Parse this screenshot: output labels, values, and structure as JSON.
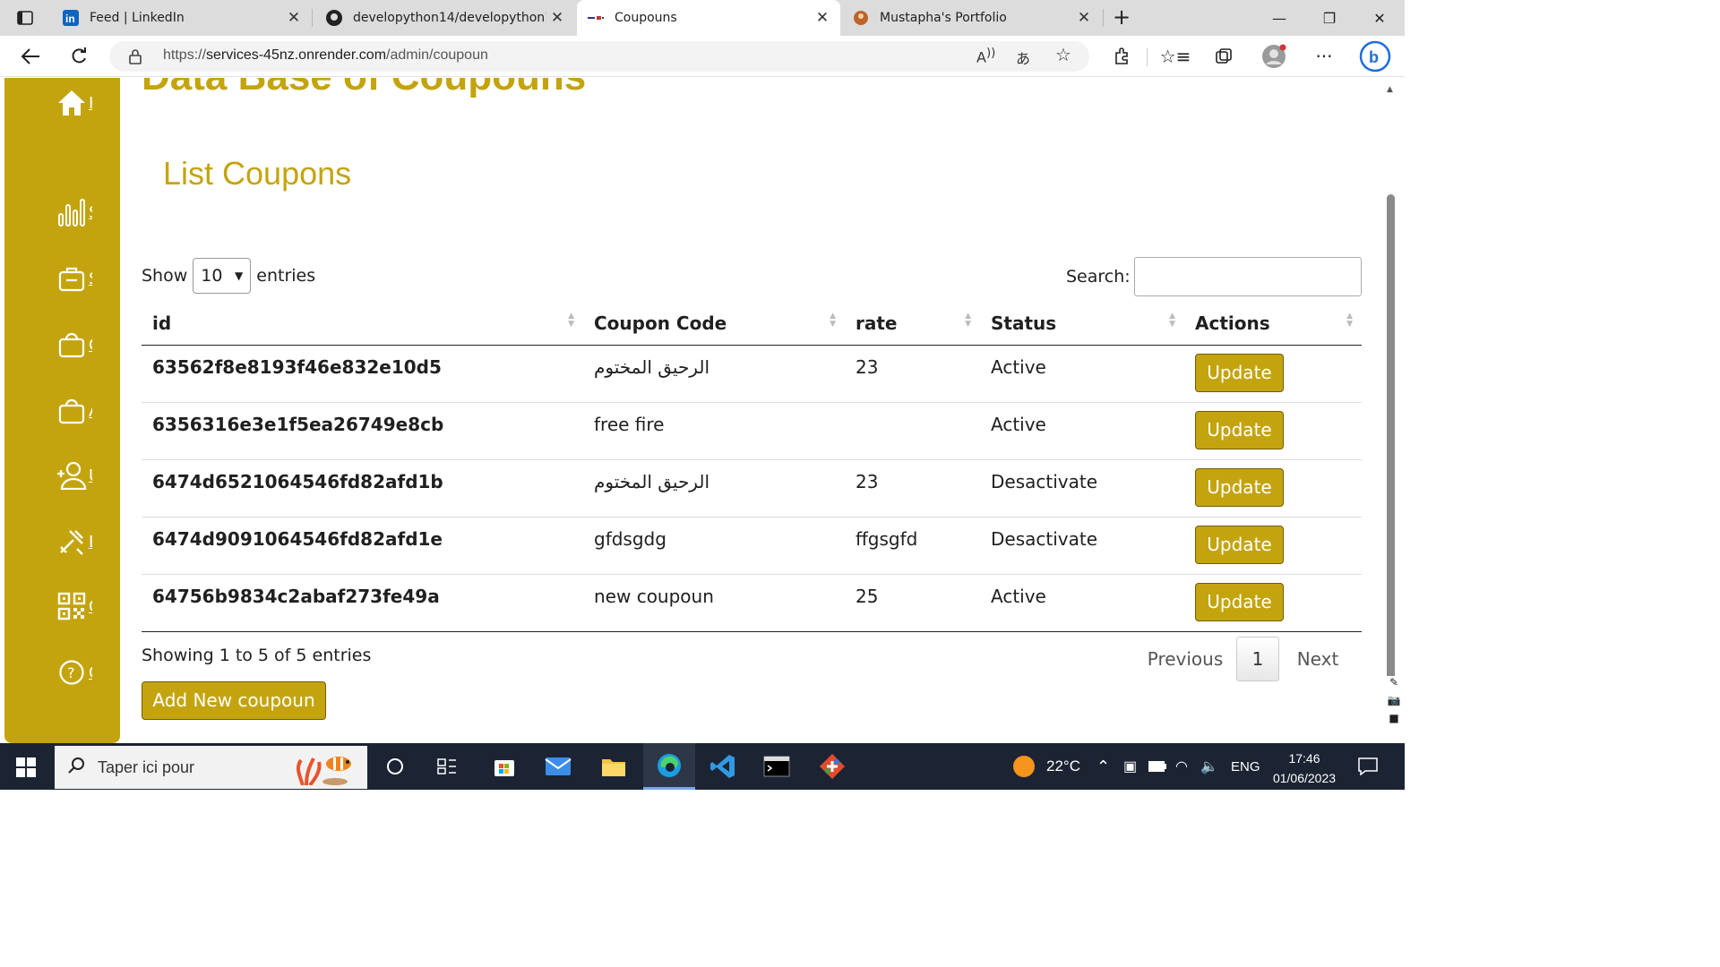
{
  "browser": {
    "tabs": [
      {
        "title": "Feed | LinkedIn",
        "icon": "linkedin-icon"
      },
      {
        "title": "developython14/developython14",
        "icon": "github-icon"
      },
      {
        "title": "Coupouns",
        "icon": "site-icon",
        "active": true
      },
      {
        "title": "Mustapha's Portfolio",
        "icon": "portfolio-icon"
      }
    ],
    "url_prefix": "https://",
    "url_host": "services-45nz.onrender.com",
    "url_path": "/admin/coupoun"
  },
  "page": {
    "heading": "Data Base of Coupouns",
    "list_title": "List Coupons",
    "length": {
      "show": "Show",
      "value": "10",
      "entries": "entries"
    },
    "search_label": "Search:",
    "columns": [
      "id",
      "Coupon Code",
      "rate",
      "Status",
      "Actions"
    ],
    "rows": [
      {
        "id": "63562f8e8193f46e832e10d5",
        "code": "الرحيق المختوم",
        "rate": "23",
        "status": "Active",
        "action": "Update"
      },
      {
        "id": "6356316e3e1f5ea26749e8cb",
        "code": "free fire",
        "rate": "",
        "status": "Active",
        "action": "Update"
      },
      {
        "id": "6474d6521064546fd82afd1b",
        "code": "الرحيق المختوم",
        "rate": "23",
        "status": "Desactivate",
        "action": "Update"
      },
      {
        "id": "6474d9091064546fd82afd1e",
        "code": "gfdsgdg",
        "rate": "ffgsgfd",
        "status": "Desactivate",
        "action": "Update"
      },
      {
        "id": "64756b9834c2abaf273fe49a",
        "code": "new coupoun",
        "rate": "25",
        "status": "Active",
        "action": "Update"
      }
    ],
    "info": "Showing 1 to 5 of 5 entries",
    "pager": {
      "previous": "Previous",
      "current": "1",
      "next": "Next"
    },
    "add_button": "Add New coupoun"
  },
  "sidebar": {
    "accent": "#c4a40e",
    "items": [
      "home-icon",
      "chart-icon",
      "briefcase-icon",
      "bag-icon",
      "bag-alt-icon",
      "user-add-icon",
      "tools-icon",
      "qr-code-icon",
      "help-icon"
    ]
  },
  "taskbar": {
    "search_placeholder": "Taper ici pour",
    "temperature": "22°C",
    "language": "ENG",
    "time": "17:46",
    "date": "01/06/2023"
  }
}
